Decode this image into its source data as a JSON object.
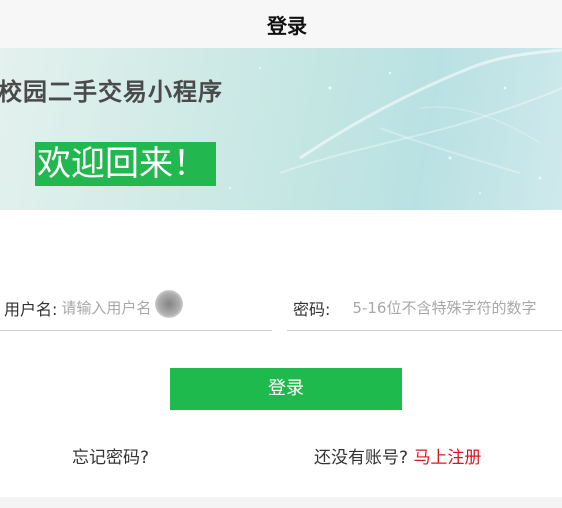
{
  "nav": {
    "title": "登录"
  },
  "banner": {
    "title": "校园二手交易小程序",
    "welcome": "欢迎回来！"
  },
  "form": {
    "username_label": "用户名:",
    "username_placeholder": "请输入用户名",
    "password_label": "密码:",
    "password_placeholder": "5-16位不含特殊字符的数字"
  },
  "actions": {
    "login_label": "登录",
    "forgot_label": "忘记密码?",
    "no_account_text": "还没有账号?",
    "register_label": "马上注册"
  },
  "colors": {
    "primary_green": "#1fba4e",
    "register_red": "#e0141e"
  }
}
